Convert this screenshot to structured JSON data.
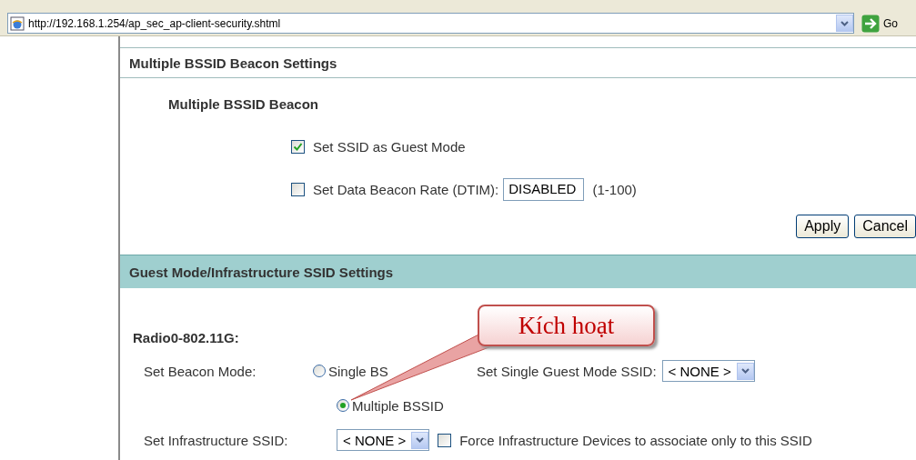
{
  "address_bar": {
    "url": "http://192.168.1.254/ap_sec_ap-client-security.shtml",
    "go_label": "Go"
  },
  "beacon_section": {
    "title": "Multiple BSSID Beacon Settings",
    "subtitle": "Multiple BSSID Beacon",
    "options": [
      {
        "kind": "check",
        "label": "Set SSID as Guest Mode",
        "checked": true
      },
      {
        "kind": "check-input",
        "label": "Set Data Beacon Rate (DTIM):",
        "checked": false,
        "value": "DISABLED",
        "hint": "(1-100)"
      }
    ],
    "buttons": [
      "Apply",
      "Cancel"
    ]
  },
  "ssid_section": {
    "title": "Guest Mode/Infrastructure SSID Settings",
    "radio_title": "Radio0-802.11G:",
    "beacon_mode_label": "Set Beacon Mode:",
    "modes": [
      {
        "label": "Single BS",
        "selected": false
      },
      {
        "label": "Multiple BSSID",
        "selected": true
      }
    ],
    "single_guest_label": "Set Single Guest Mode SSID:",
    "single_guest_value": "< NONE >",
    "infra_label": "Set Infrastructure SSID:",
    "infra_value": "< NONE >",
    "force": {
      "label": "Force Infrastructure Devices to associate only to this SSID",
      "checked": false
    }
  },
  "callout": {
    "text": "Kích hoạt"
  }
}
